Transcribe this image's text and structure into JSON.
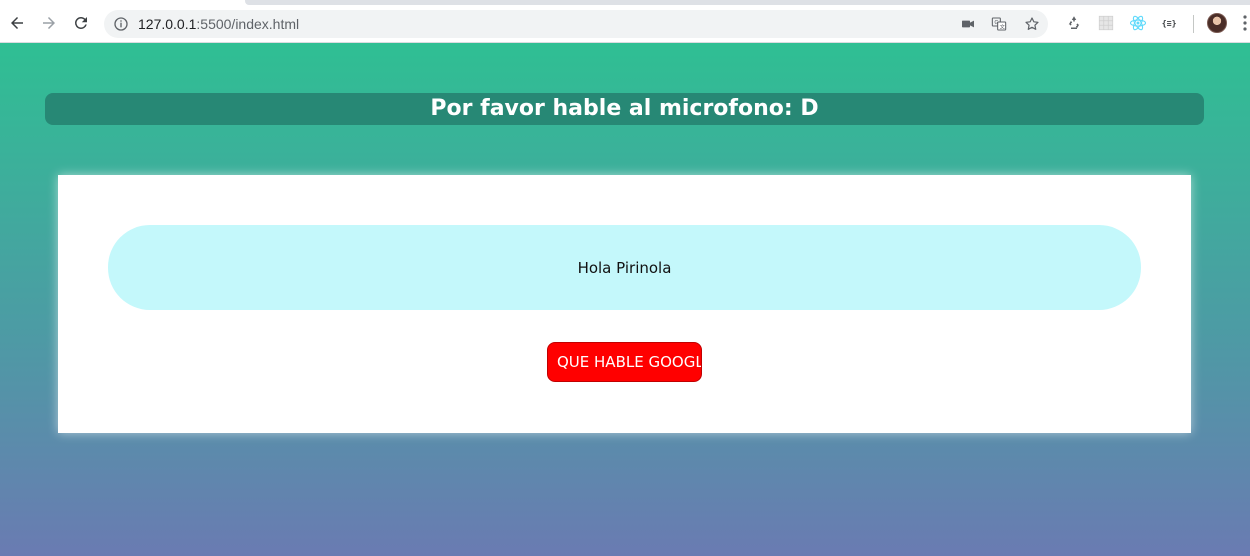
{
  "browser": {
    "url_host": "127.0.0.1",
    "url_rest": ":5500/index.html",
    "icons": {
      "back": "back-arrow-icon",
      "forward": "forward-arrow-icon",
      "reload": "reload-icon",
      "site_info": "info-icon",
      "camera": "camera-icon",
      "translate": "translate-icon",
      "bookmark": "star-icon",
      "extensions": [
        "recycle-icon",
        "grid-icon",
        "react-icon",
        "json-icon"
      ],
      "menu": "more-vert-icon"
    }
  },
  "page": {
    "banner_text": "Por favor hable al microfono: D",
    "message_text": "Hola Pirinola",
    "speak_button_label": "QUE HABLE GOOGLE"
  },
  "colors": {
    "gradient_top": "#2fbf93",
    "gradient_bottom": "#6a7bb2",
    "banner_bg": "#278875",
    "message_bg": "#c4f8fb",
    "button_bg": "#ff0000"
  }
}
